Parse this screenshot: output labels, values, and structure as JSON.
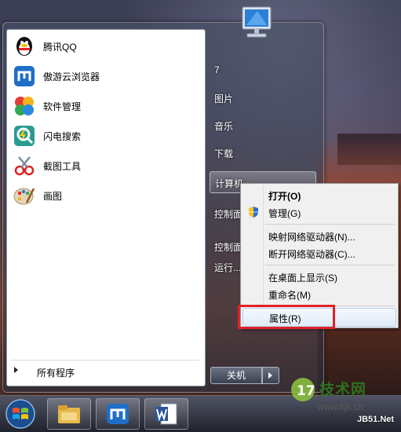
{
  "start_menu": {
    "pinned": [
      {
        "label": "腾讯QQ",
        "icon": "qq-penguin-icon"
      },
      {
        "label": "傲游云浏览器",
        "icon": "maxthon-browser-icon"
      },
      {
        "label": "软件管理",
        "icon": "software-manager-icon"
      },
      {
        "label": "闪电搜索",
        "icon": "lightning-search-icon"
      },
      {
        "label": "截图工具",
        "icon": "snipping-tool-icon"
      },
      {
        "label": "画图",
        "icon": "paint-palette-icon"
      }
    ],
    "all_programs": "所有程序",
    "right_items": [
      "7",
      "图片",
      "音乐",
      "下载",
      "计算机",
      "控制面",
      "控制面",
      "运行..."
    ],
    "shutdown_label": "关机"
  },
  "context_menu": {
    "items": [
      {
        "label": "打开(O)",
        "bold": true
      },
      {
        "label": "管理(G)",
        "icon": "uac-shield-icon"
      },
      {
        "label": "映射网络驱动器(N)..."
      },
      {
        "label": "断开网络驱动器(C)..."
      },
      {
        "label": "在桌面上显示(S)"
      },
      {
        "label": "重命名(M)"
      },
      {
        "label": "属性(R)",
        "highlighted": true
      }
    ]
  },
  "taskbar": {
    "apps": [
      "windows-explorer-icon",
      "maxthon-browser-icon",
      "word-document-icon"
    ]
  },
  "watermark": {
    "brand": "技术网",
    "url": "www.itjs.cn",
    "site": "JB51.Net"
  },
  "colors": {
    "highlight_box": "#e0222a"
  }
}
